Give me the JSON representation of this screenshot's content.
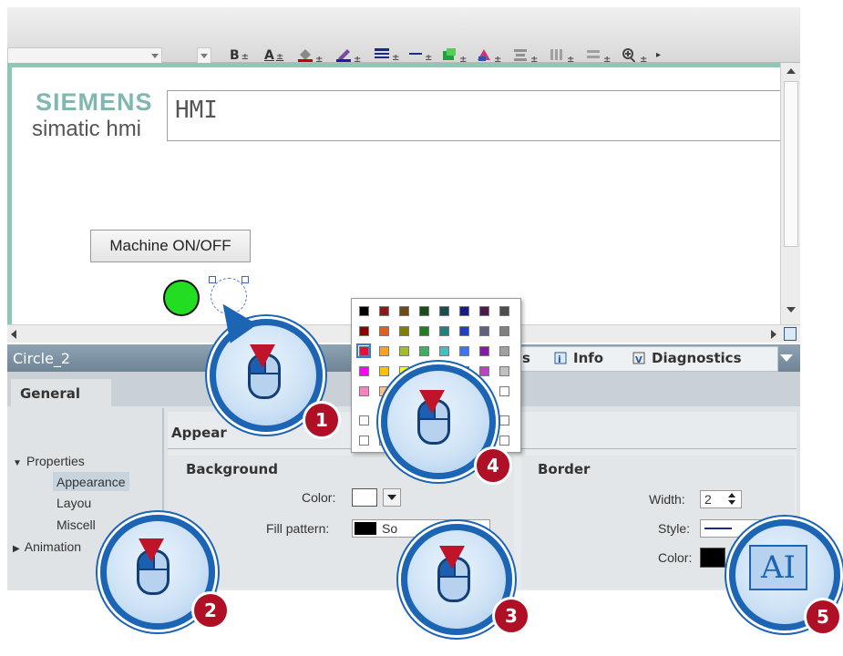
{
  "toolbar": {
    "bold": "B",
    "text_color": "A",
    "zoom_icon": "zoom-in-icon"
  },
  "screen": {
    "brand": "SIEMENS",
    "brand_sub": "simatic hmi",
    "title_text": "HMI",
    "button_label": "Machine ON/OFF",
    "circle1_color": "#22dd22"
  },
  "inspector": {
    "object_name": "Circle_2",
    "tab_partial": "s",
    "tab_info": "Info",
    "tab_diagnostics": "Diagnostics",
    "general_tab": "General",
    "section_partial": "Appear",
    "tree": {
      "properties": "Properties",
      "appearance": "Appearance",
      "layout": "Layou",
      "misc": "Miscell",
      "animations": "Animation"
    },
    "background": {
      "header": "Background",
      "color_label": "Color:",
      "fill_label": "Fill pattern:",
      "fill_value": "So"
    },
    "border": {
      "header": "Border",
      "width_label": "Width:",
      "width_value": "2",
      "style_label": "Style:",
      "color_label": "Color:"
    }
  },
  "palette": {
    "rows": [
      [
        "#000000",
        "#8b1a1a",
        "#6b4a1a",
        "#1a4d1a",
        "#1a4d4d",
        "#1a1a8b",
        "#4d1a4d",
        "#4d4d4d"
      ],
      [
        "#8b0000",
        "#e06020",
        "#808000",
        "#208020",
        "#208080",
        "#2040c0",
        "#606080",
        "#808080"
      ],
      [
        "#e01040",
        "#ffa020",
        "#a0c020",
        "#40b060",
        "#40c0c0",
        "#4070ff",
        "#8020a0",
        "#a0a0a0"
      ],
      [
        "#ff00ff",
        "#ffc000",
        "#ffff00",
        "#00ff00",
        "#00ffff",
        "#00c0ff",
        "#c040c0",
        "#c0c0c0"
      ],
      [
        "#ff80c0",
        "#ffc080",
        "#ffff80",
        "#80ff80",
        "#80ffff",
        "#80c0ff",
        "#e0a0e0",
        "#ffffff"
      ]
    ],
    "custom_rows": [
      [
        "#ffffff",
        "#ffffff",
        "#ffffff",
        "#ffffff",
        "#ffffff",
        "#ffffff",
        "#ffffff",
        "#ffffff"
      ],
      [
        "#ffffff",
        "#ffffff",
        "#ffffff",
        "#ffffff",
        "#ffffff",
        "#ffffff",
        "#ffffff",
        "#ffffff"
      ]
    ]
  },
  "callouts": {
    "step1": "1",
    "step2": "2",
    "step3": "3",
    "step4": "4",
    "step5": "5",
    "text_cursor_label": "AI"
  },
  "colors": {
    "accent_teal": "#8fc7b5",
    "callout_blue": "#1c64b4",
    "step_red": "#b01025"
  }
}
